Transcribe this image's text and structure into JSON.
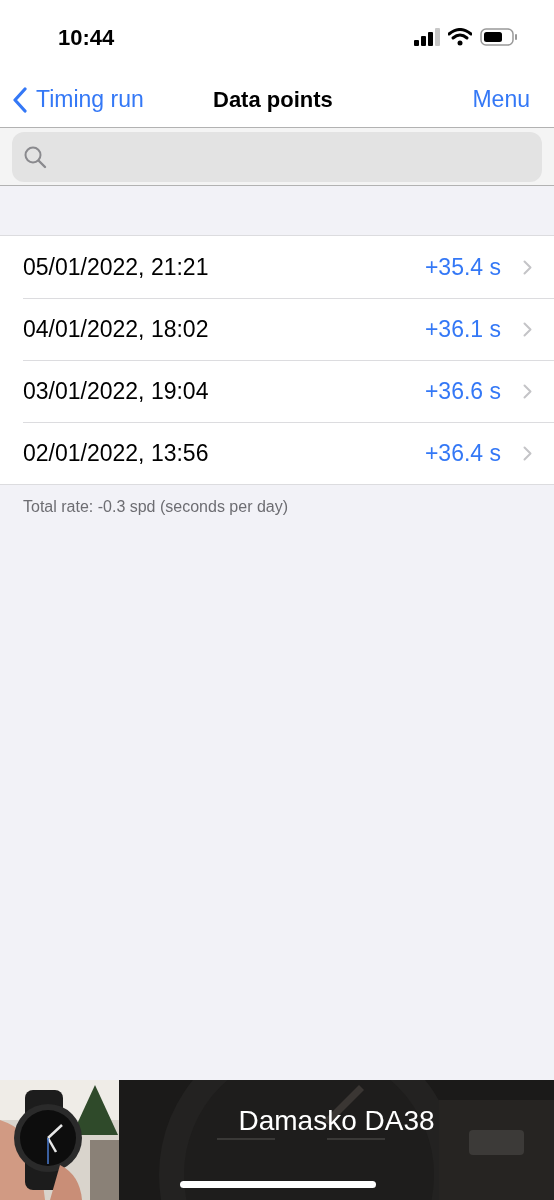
{
  "status_bar": {
    "time": "10:44"
  },
  "nav": {
    "back": "Timing run",
    "title": "Data points",
    "menu": "Menu"
  },
  "rows": [
    {
      "date": "05/01/2022, 21:21",
      "value": "+35.4 s"
    },
    {
      "date": "04/01/2022, 18:02",
      "value": "+36.1 s"
    },
    {
      "date": "03/01/2022, 19:04",
      "value": "+36.6 s"
    },
    {
      "date": "02/01/2022, 13:56",
      "value": "+36.4 s"
    }
  ],
  "footer": "Total rate: -0.3 spd (seconds per day)",
  "banner": {
    "title": "Damasko DA38"
  }
}
